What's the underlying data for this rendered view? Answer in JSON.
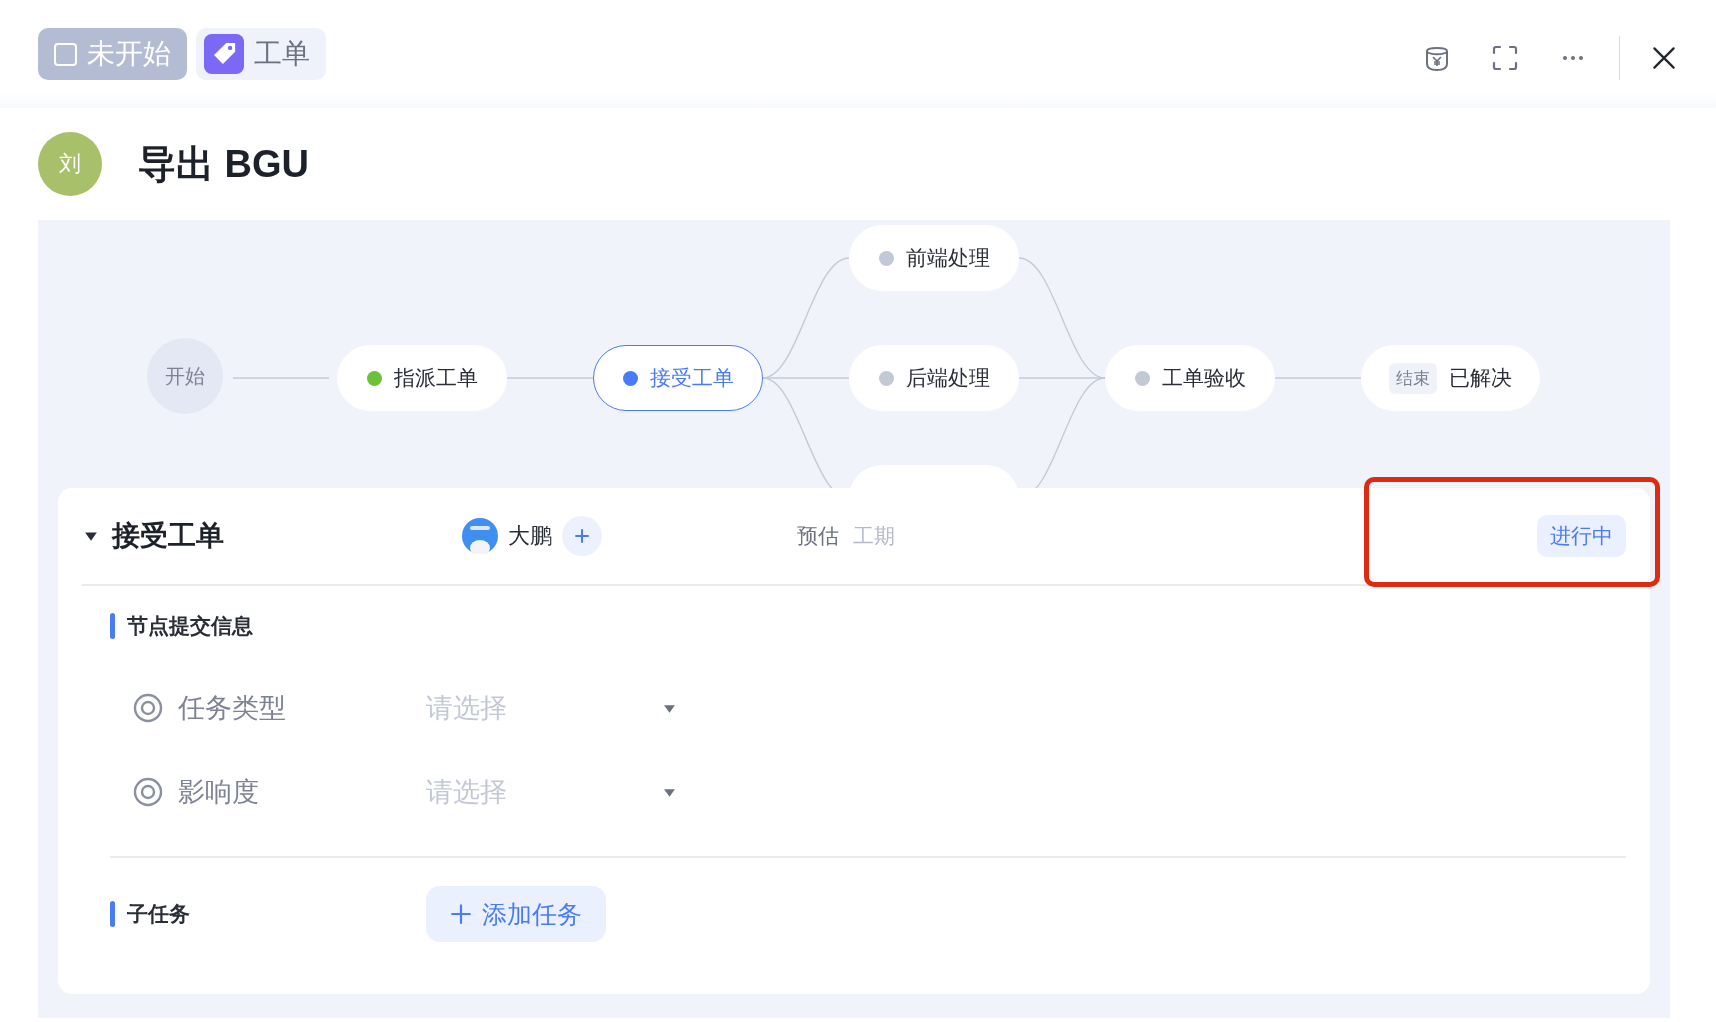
{
  "header": {
    "status_chip": {
      "label": "未开始"
    },
    "type_chip": {
      "label": "工单"
    }
  },
  "title": {
    "avatar": "刘",
    "text": "导出 BGU"
  },
  "flow": {
    "nodes": [
      {
        "kind": "start",
        "label": "开始"
      },
      {
        "kind": "step",
        "label": "指派工单",
        "done": true,
        "selected": false
      },
      {
        "kind": "step",
        "label": "接受工单",
        "done": false,
        "selected": true
      },
      {
        "kind": "step",
        "label": "前端处理",
        "done": false,
        "selected": false
      },
      {
        "kind": "step",
        "label": "后端处理",
        "done": false,
        "selected": false
      },
      {
        "kind": "step",
        "label": "工单验收",
        "done": false,
        "selected": false
      },
      {
        "kind": "end",
        "tag": "结束",
        "label": "已解决"
      }
    ]
  },
  "panel": {
    "title": "接受工单",
    "expanded": true,
    "assignee": "大鹏",
    "estimate_label": "预估",
    "estimate_value": "工期",
    "status": "进行中",
    "sections": [
      {
        "kind": "form",
        "title": "节点提交信息",
        "fields": [
          {
            "label": "任务类型",
            "placeholder": "请选择"
          },
          {
            "label": "影响度",
            "placeholder": "请选择"
          }
        ]
      },
      {
        "kind": "subtasks",
        "title": "子任务",
        "button": "添加任务"
      }
    ]
  }
}
